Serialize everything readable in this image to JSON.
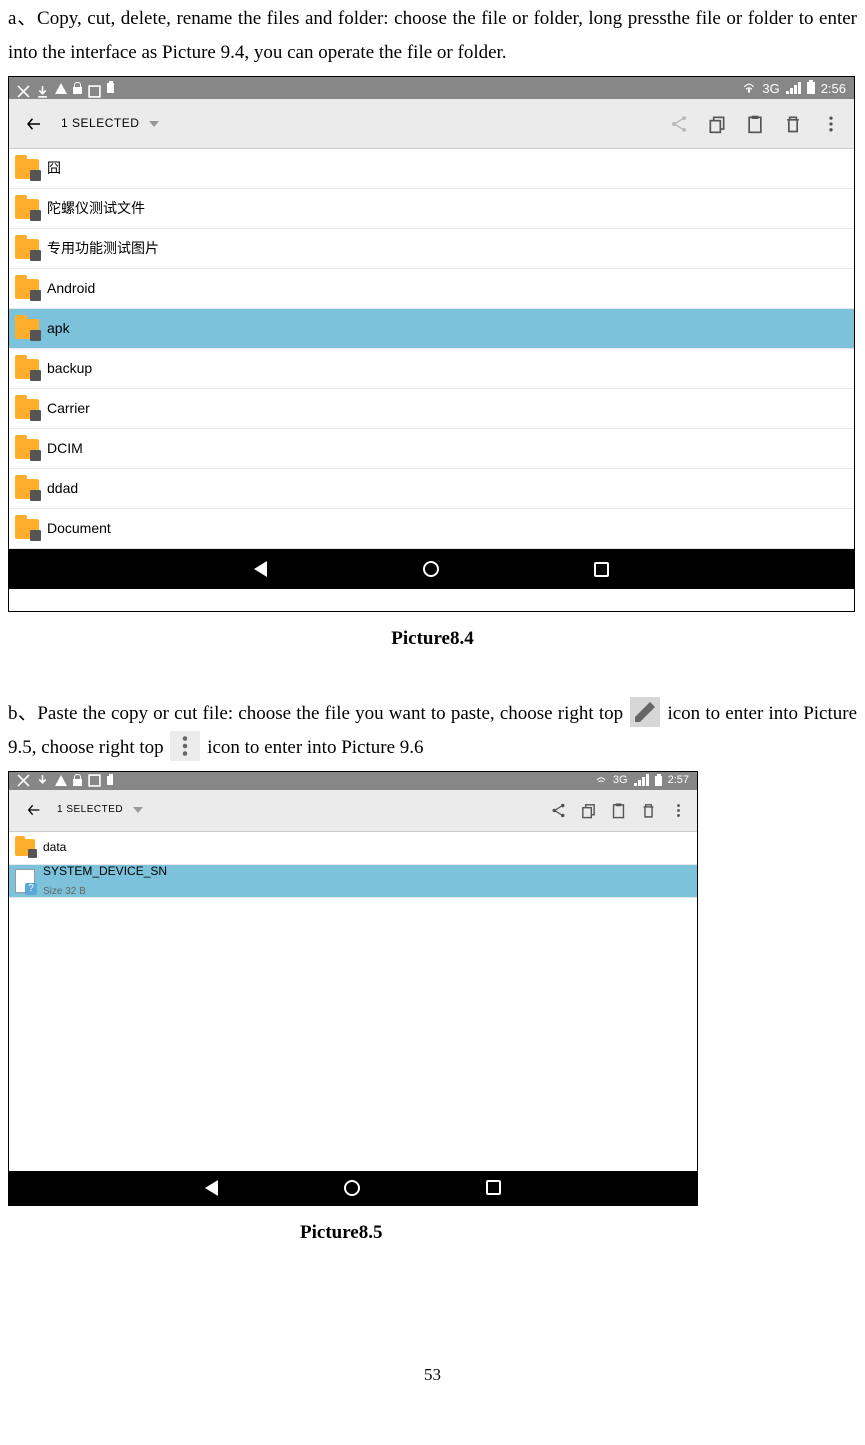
{
  "para_a": "a、Copy, cut, delete, rename the files and folder: choose the file or folder, long pressthe file or folder to enter into the interface as Picture 9.4, you can operate the file or folder.",
  "caption1": "Picture8.4",
  "para_b_1": "b、Paste the copy or cut file: choose the file you want to paste, choose right top",
  "para_b_2": "icon to enter into Picture 9.5, choose right top",
  "para_b_3": "icon to enter into Picture 9.6",
  "caption2": "Picture8.5",
  "pagenum": "53",
  "sc1": {
    "statusbar": {
      "signal": "3G",
      "batt": "",
      "time": "2:56"
    },
    "selection": "1 SELECTED",
    "folders": [
      "囧",
      "陀螺仪测试文件",
      "专用功能测试图片",
      "Android",
      "apk",
      "backup",
      "Carrier",
      "DCIM",
      "ddad",
      "Document"
    ],
    "selected_index": 4
  },
  "sc2": {
    "statusbar": {
      "signal": "3G",
      "batt": "",
      "time": "2:57"
    },
    "selection": "1 SELECTED",
    "items": [
      {
        "type": "folder",
        "name": "data"
      },
      {
        "type": "file",
        "name": "SYSTEM_DEVICE_SN",
        "meta": "Size 32 B"
      }
    ],
    "selected_index": 1
  }
}
